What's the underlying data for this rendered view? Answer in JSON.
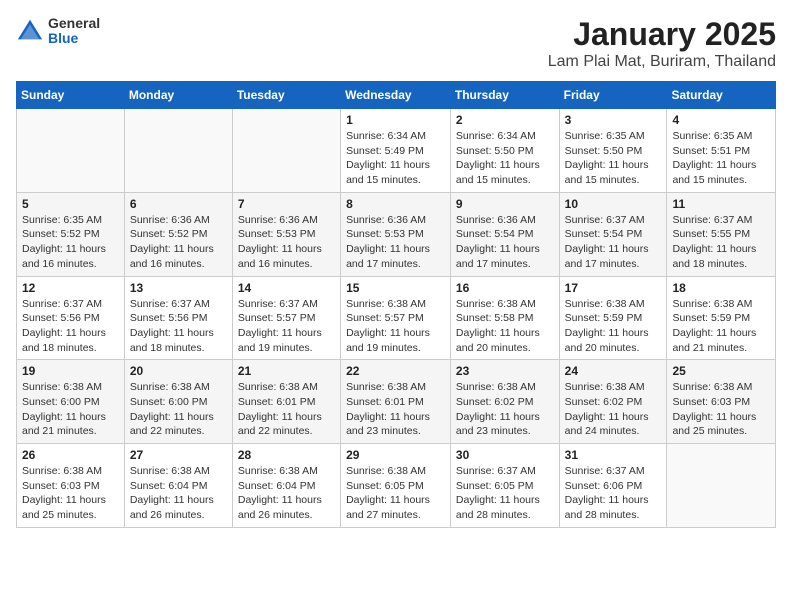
{
  "logo": {
    "general": "General",
    "blue": "Blue"
  },
  "title": "January 2025",
  "subtitle": "Lam Plai Mat, Buriram, Thailand",
  "days_of_week": [
    "Sunday",
    "Monday",
    "Tuesday",
    "Wednesday",
    "Thursday",
    "Friday",
    "Saturday"
  ],
  "weeks": [
    [
      {
        "day": "",
        "info": ""
      },
      {
        "day": "",
        "info": ""
      },
      {
        "day": "",
        "info": ""
      },
      {
        "day": "1",
        "info": "Sunrise: 6:34 AM\nSunset: 5:49 PM\nDaylight: 11 hours and 15 minutes."
      },
      {
        "day": "2",
        "info": "Sunrise: 6:34 AM\nSunset: 5:50 PM\nDaylight: 11 hours and 15 minutes."
      },
      {
        "day": "3",
        "info": "Sunrise: 6:35 AM\nSunset: 5:50 PM\nDaylight: 11 hours and 15 minutes."
      },
      {
        "day": "4",
        "info": "Sunrise: 6:35 AM\nSunset: 5:51 PM\nDaylight: 11 hours and 15 minutes."
      }
    ],
    [
      {
        "day": "5",
        "info": "Sunrise: 6:35 AM\nSunset: 5:52 PM\nDaylight: 11 hours and 16 minutes."
      },
      {
        "day": "6",
        "info": "Sunrise: 6:36 AM\nSunset: 5:52 PM\nDaylight: 11 hours and 16 minutes."
      },
      {
        "day": "7",
        "info": "Sunrise: 6:36 AM\nSunset: 5:53 PM\nDaylight: 11 hours and 16 minutes."
      },
      {
        "day": "8",
        "info": "Sunrise: 6:36 AM\nSunset: 5:53 PM\nDaylight: 11 hours and 17 minutes."
      },
      {
        "day": "9",
        "info": "Sunrise: 6:36 AM\nSunset: 5:54 PM\nDaylight: 11 hours and 17 minutes."
      },
      {
        "day": "10",
        "info": "Sunrise: 6:37 AM\nSunset: 5:54 PM\nDaylight: 11 hours and 17 minutes."
      },
      {
        "day": "11",
        "info": "Sunrise: 6:37 AM\nSunset: 5:55 PM\nDaylight: 11 hours and 18 minutes."
      }
    ],
    [
      {
        "day": "12",
        "info": "Sunrise: 6:37 AM\nSunset: 5:56 PM\nDaylight: 11 hours and 18 minutes."
      },
      {
        "day": "13",
        "info": "Sunrise: 6:37 AM\nSunset: 5:56 PM\nDaylight: 11 hours and 18 minutes."
      },
      {
        "day": "14",
        "info": "Sunrise: 6:37 AM\nSunset: 5:57 PM\nDaylight: 11 hours and 19 minutes."
      },
      {
        "day": "15",
        "info": "Sunrise: 6:38 AM\nSunset: 5:57 PM\nDaylight: 11 hours and 19 minutes."
      },
      {
        "day": "16",
        "info": "Sunrise: 6:38 AM\nSunset: 5:58 PM\nDaylight: 11 hours and 20 minutes."
      },
      {
        "day": "17",
        "info": "Sunrise: 6:38 AM\nSunset: 5:59 PM\nDaylight: 11 hours and 20 minutes."
      },
      {
        "day": "18",
        "info": "Sunrise: 6:38 AM\nSunset: 5:59 PM\nDaylight: 11 hours and 21 minutes."
      }
    ],
    [
      {
        "day": "19",
        "info": "Sunrise: 6:38 AM\nSunset: 6:00 PM\nDaylight: 11 hours and 21 minutes."
      },
      {
        "day": "20",
        "info": "Sunrise: 6:38 AM\nSunset: 6:00 PM\nDaylight: 11 hours and 22 minutes."
      },
      {
        "day": "21",
        "info": "Sunrise: 6:38 AM\nSunset: 6:01 PM\nDaylight: 11 hours and 22 minutes."
      },
      {
        "day": "22",
        "info": "Sunrise: 6:38 AM\nSunset: 6:01 PM\nDaylight: 11 hours and 23 minutes."
      },
      {
        "day": "23",
        "info": "Sunrise: 6:38 AM\nSunset: 6:02 PM\nDaylight: 11 hours and 23 minutes."
      },
      {
        "day": "24",
        "info": "Sunrise: 6:38 AM\nSunset: 6:02 PM\nDaylight: 11 hours and 24 minutes."
      },
      {
        "day": "25",
        "info": "Sunrise: 6:38 AM\nSunset: 6:03 PM\nDaylight: 11 hours and 25 minutes."
      }
    ],
    [
      {
        "day": "26",
        "info": "Sunrise: 6:38 AM\nSunset: 6:03 PM\nDaylight: 11 hours and 25 minutes."
      },
      {
        "day": "27",
        "info": "Sunrise: 6:38 AM\nSunset: 6:04 PM\nDaylight: 11 hours and 26 minutes."
      },
      {
        "day": "28",
        "info": "Sunrise: 6:38 AM\nSunset: 6:04 PM\nDaylight: 11 hours and 26 minutes."
      },
      {
        "day": "29",
        "info": "Sunrise: 6:38 AM\nSunset: 6:05 PM\nDaylight: 11 hours and 27 minutes."
      },
      {
        "day": "30",
        "info": "Sunrise: 6:37 AM\nSunset: 6:05 PM\nDaylight: 11 hours and 28 minutes."
      },
      {
        "day": "31",
        "info": "Sunrise: 6:37 AM\nSunset: 6:06 PM\nDaylight: 11 hours and 28 minutes."
      },
      {
        "day": "",
        "info": ""
      }
    ]
  ]
}
